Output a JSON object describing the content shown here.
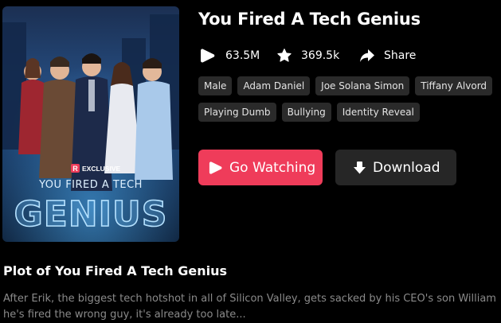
{
  "drama": {
    "title": "You Fired A Tech Genius",
    "poster": {
      "badge": "EXCLUSIVE",
      "badge_mark": "R",
      "subtitle": "YOU FIRED A TECH",
      "headline": "GENIUS"
    },
    "stats": {
      "plays": "63.5M",
      "favorites": "369.5k",
      "share_label": "Share"
    },
    "tags": [
      "Male",
      "Adam Daniel",
      "Joe Solana Simon",
      "Tiffany Alvord",
      "Playing Dumb",
      "Bullying",
      "Identity Reveal"
    ]
  },
  "actions": {
    "watch_label": "Go Watching",
    "download_label": "Download"
  },
  "plot": {
    "heading": "Plot of You Fired A Tech Genius",
    "line1": "After Erik, the biggest tech hotshot in all of Silicon Valley, gets sacked by his CEO's son William, h",
    "line2": "he's fired the wrong guy, it's already too late..."
  },
  "colors": {
    "background": "#000000",
    "accent": "#ef3c5a",
    "secondary_button": "#262626",
    "tag_background": "#2a2a2a",
    "muted_text": "#8a8a8a"
  },
  "icons": {
    "plays": "play-icon",
    "favorites": "star-icon",
    "share": "share-arrow-icon",
    "watch": "play-icon",
    "download": "download-arrow-icon"
  }
}
